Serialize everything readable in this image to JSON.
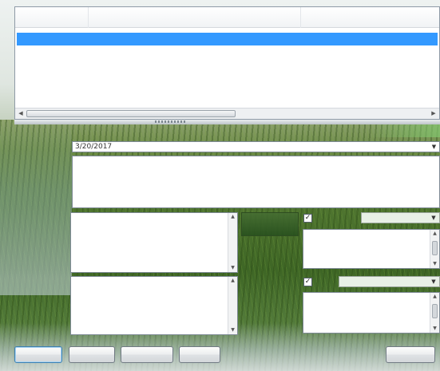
{
  "list": {
    "columns": [
      "",
      "",
      ""
    ],
    "rows": [
      {
        "date": "",
        "description": "",
        "details": "",
        "selected": true
      }
    ]
  },
  "form": {
    "labels": {
      "date": "",
      "notes1": "",
      "notes2": ""
    },
    "date_value": "3/20/2017",
    "main_text": "",
    "notes1_lines": [
      "",
      "",
      "",
      ""
    ],
    "notes2_lines": [
      "",
      "",
      "",
      ""
    ],
    "middle_button": "",
    "check1_label": "",
    "check2_label": "",
    "side_text1_lines": [
      "",
      "",
      ""
    ],
    "side_text2_lines": [
      "",
      "",
      ""
    ]
  },
  "buttons": {
    "b1": "",
    "b2": "",
    "b3": "",
    "b4": "",
    "b5": ""
  },
  "colors": {
    "selection": "#3399ff",
    "primary_border": "#3c7fb1"
  },
  "icons": {
    "dropdown": "chevron-down-icon",
    "scroll_up": "scroll-up-icon",
    "scroll_down": "scroll-down-icon"
  }
}
